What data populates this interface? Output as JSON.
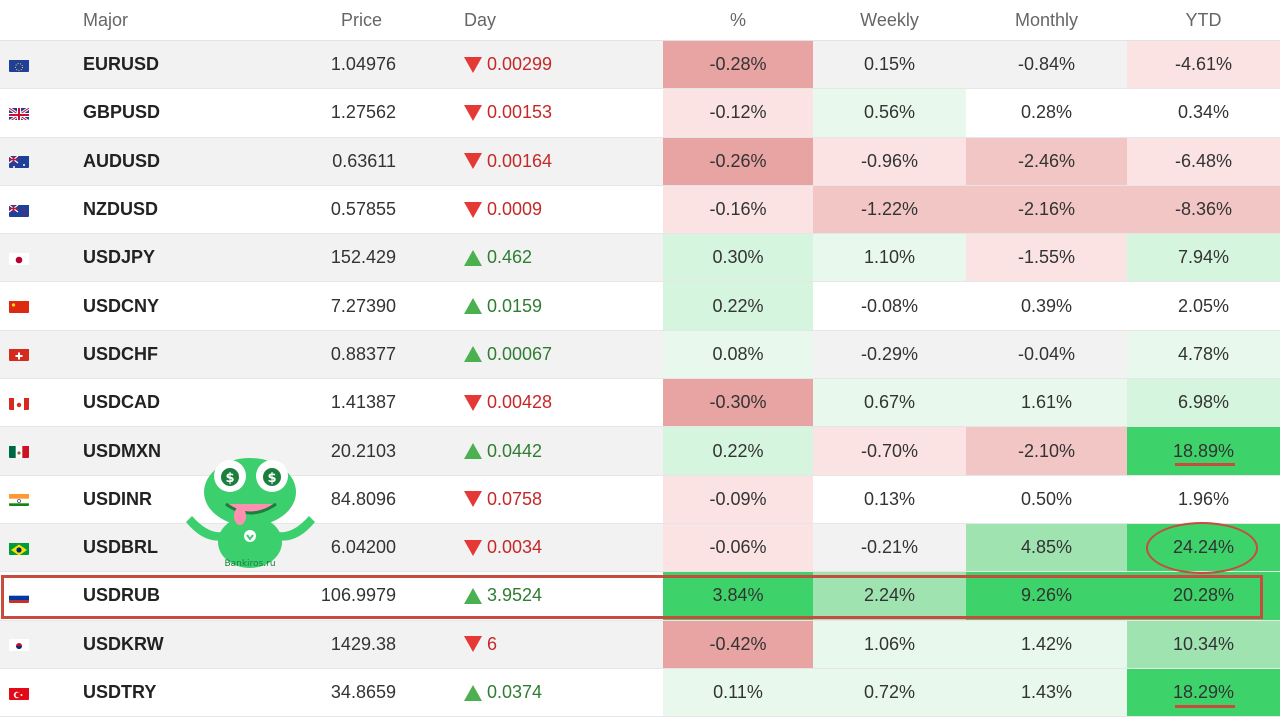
{
  "headers": {
    "major": "Major",
    "price": "Price",
    "day": "Day",
    "pct": "%",
    "weekly": "Weekly",
    "monthly": "Monthly",
    "ytd": "YTD"
  },
  "rows": [
    {
      "pair": "EURUSD",
      "flag": "eu-flag-icon",
      "price": "1.04976",
      "day": "0.00299",
      "dir": "down",
      "pct": "-0.28%",
      "weekly": "0.15%",
      "monthly": "-0.84%",
      "ytd": "-4.61%"
    },
    {
      "pair": "GBPUSD",
      "flag": "uk-flag-icon",
      "price": "1.27562",
      "day": "0.00153",
      "dir": "down",
      "pct": "-0.12%",
      "weekly": "0.56%",
      "monthly": "0.28%",
      "ytd": "0.34%"
    },
    {
      "pair": "AUDUSD",
      "flag": "au-flag-icon",
      "price": "0.63611",
      "day": "0.00164",
      "dir": "down",
      "pct": "-0.26%",
      "weekly": "-0.96%",
      "monthly": "-2.46%",
      "ytd": "-6.48%"
    },
    {
      "pair": "NZDUSD",
      "flag": "nz-flag-icon",
      "price": "0.57855",
      "day": "0.0009",
      "dir": "down",
      "pct": "-0.16%",
      "weekly": "-1.22%",
      "monthly": "-2.16%",
      "ytd": "-8.36%"
    },
    {
      "pair": "USDJPY",
      "flag": "jp-flag-icon",
      "price": "152.429",
      "day": "0.462",
      "dir": "up",
      "pct": "0.30%",
      "weekly": "1.10%",
      "monthly": "-1.55%",
      "ytd": "7.94%"
    },
    {
      "pair": "USDCNY",
      "flag": "cn-flag-icon",
      "price": "7.27390",
      "day": "0.0159",
      "dir": "up",
      "pct": "0.22%",
      "weekly": "-0.08%",
      "monthly": "0.39%",
      "ytd": "2.05%"
    },
    {
      "pair": "USDCHF",
      "flag": "ch-flag-icon",
      "price": "0.88377",
      "day": "0.00067",
      "dir": "up",
      "pct": "0.08%",
      "weekly": "-0.29%",
      "monthly": "-0.04%",
      "ytd": "4.78%"
    },
    {
      "pair": "USDCAD",
      "flag": "ca-flag-icon",
      "price": "1.41387",
      "day": "0.00428",
      "dir": "down",
      "pct": "-0.30%",
      "weekly": "0.67%",
      "monthly": "1.61%",
      "ytd": "6.98%"
    },
    {
      "pair": "USDMXN",
      "flag": "mx-flag-icon",
      "price": "20.2103",
      "day": "0.0442",
      "dir": "up",
      "pct": "0.22%",
      "weekly": "-0.70%",
      "monthly": "-2.10%",
      "ytd": "18.89%"
    },
    {
      "pair": "USDINR",
      "flag": "in-flag-icon",
      "price": "84.8096",
      "day": "0.0758",
      "dir": "down",
      "pct": "-0.09%",
      "weekly": "0.13%",
      "monthly": "0.50%",
      "ytd": "1.96%"
    },
    {
      "pair": "USDBRL",
      "flag": "br-flag-icon",
      "price": "6.04200",
      "day": "0.0034",
      "dir": "down",
      "pct": "-0.06%",
      "weekly": "-0.21%",
      "monthly": "4.85%",
      "ytd": "24.24%"
    },
    {
      "pair": "USDRUB",
      "flag": "ru-flag-icon",
      "price": "106.9979",
      "day": "3.9524",
      "dir": "up",
      "pct": "3.84%",
      "weekly": "2.24%",
      "monthly": "9.26%",
      "ytd": "20.28%"
    },
    {
      "pair": "USDKRW",
      "flag": "kr-flag-icon",
      "price": "1429.38",
      "day": "6",
      "dir": "down",
      "pct": "-0.42%",
      "weekly": "1.06%",
      "monthly": "1.42%",
      "ytd": "10.34%"
    },
    {
      "pair": "USDTRY",
      "flag": "tr-flag-icon",
      "price": "34.8659",
      "day": "0.0374",
      "dir": "up",
      "pct": "0.11%",
      "weekly": "0.72%",
      "monthly": "1.43%",
      "ytd": "18.29%"
    }
  ],
  "heat_colors": {
    "neg_strong": "#e8a3a3",
    "neg_medium": "#f3c6c6",
    "neg_light": "#fbe3e3",
    "pos_strong": "#3ed36a",
    "pos_medium": "#9fe3b1",
    "pos_light": "#d6f5de",
    "pos_faint": "#e8f8ec",
    "arrow_down": "#e53935",
    "arrow_up": "#4caf50",
    "annotation": "#c84b3f"
  },
  "watermark": {
    "label": "Bankiros.ru"
  }
}
